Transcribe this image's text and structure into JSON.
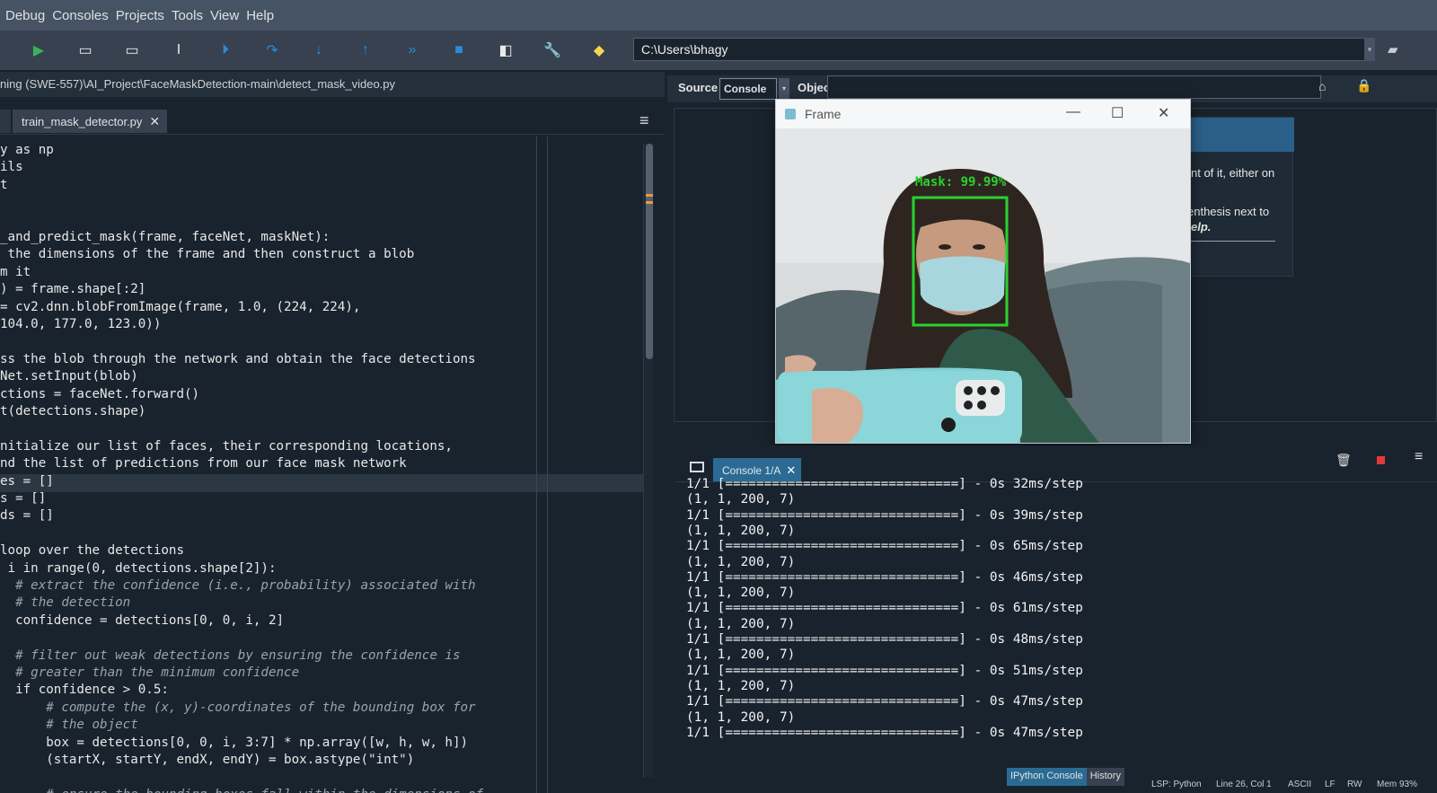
{
  "menu": [
    "Debug",
    "Consoles",
    "Projects",
    "Tools",
    "View",
    "Help"
  ],
  "toolbar": {
    "path": "C:\\Users\\bhagy"
  },
  "editor": {
    "file_path": "ning (SWE-557)\\AI_Project\\FaceMaskDetection-main\\detect_mask_video.py",
    "tab_label": "train_mask_detector.py",
    "tab_close": "✕",
    "code_lines": [
      "y as np",
      "ils",
      "t",
      "",
      "",
      "_and_predict_mask(frame, faceNet, maskNet):",
      " the dimensions of the frame and then construct a blob",
      "m it",
      ") = frame.shape[:2]",
      "= cv2.dnn.blobFromImage(frame, 1.0, (224, 224),",
      "104.0, 177.0, 123.0))",
      "",
      "ss the blob through the network and obtain the face detections",
      "Net.setInput(blob)",
      "ctions = faceNet.forward()",
      "t(detections.shape)",
      "",
      "nitialize our list of faces, their corresponding locations,",
      "nd the list of predictions from our face mask network",
      "es = []",
      "s = []",
      "ds = []",
      "",
      "loop over the detections",
      " i in range(0, detections.shape[2]):",
      "  # extract the confidence (i.e., probability) associated with",
      "  # the detection",
      "  confidence = detections[0, 0, i, 2]",
      "",
      "  # filter out weak detections by ensuring the confidence is",
      "  # greater than the minimum confidence",
      "  if confidence > 0.5:",
      "      # compute the (x, y)-coordinates of the bounding box for",
      "      # the object",
      "      box = detections[0, 0, i, 3:7] * np.array([w, h, w, h])",
      "      (startX, startY, endX, endY) = box.astype(\"int\")",
      "",
      "      # ensure the bounding boxes fall within the dimensions of"
    ]
  },
  "help": {
    "source_label": "Source",
    "console_option": "Console",
    "object_label": "Object",
    "text1": "nt of it, either on",
    "text2": "enthesis next to",
    "text3": "elp."
  },
  "frame_window": {
    "title": "Frame",
    "minimize": "—",
    "maximize": "☐",
    "close": "✕",
    "detection_label": "Mask: 99.99%"
  },
  "console": {
    "tab_label": "Console 1/A",
    "tab_close": "✕",
    "lines": [
      "1/1 [==============================] - 0s 32ms/step",
      "(1, 1, 200, 7)",
      "1/1 [==============================] - 0s 39ms/step",
      "(1, 1, 200, 7)",
      "1/1 [==============================] - 0s 65ms/step",
      "(1, 1, 200, 7)",
      "1/1 [==============================] - 0s 46ms/step",
      "(1, 1, 200, 7)",
      "1/1 [==============================] - 0s 61ms/step",
      "(1, 1, 200, 7)",
      "1/1 [==============================] - 0s 48ms/step",
      "(1, 1, 200, 7)",
      "1/1 [==============================] - 0s 51ms/step",
      "(1, 1, 200, 7)",
      "1/1 [==============================] - 0s 47ms/step",
      "(1, 1, 200, 7)",
      "1/1 [==============================] - 0s 47ms/step"
    ],
    "bottom_tabs": [
      "IPython Console",
      "History"
    ]
  },
  "status": {
    "lsp": "LSP: Python",
    "position": "Line 26, Col 1",
    "encoding": "ASCII",
    "eol": "LF",
    "rw": "RW",
    "mem": "Mem 93%"
  },
  "colors": {
    "background": "#19232d",
    "accent": "#2b6b93",
    "detection_box": "#29d22e"
  }
}
